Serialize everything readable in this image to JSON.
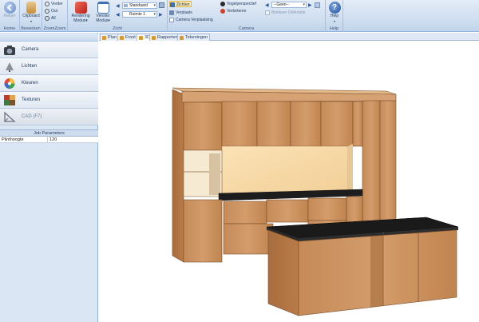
{
  "ribbon": {
    "home": {
      "return_label": "Return",
      "group_label": "Home"
    },
    "bewerken": {
      "clipboard_label": "Clipboard",
      "group_label": "Bewerken"
    },
    "zoom": {
      "items": [
        "Vorder",
        "Out",
        "All"
      ],
      "group_label": "ZoomZoom"
    },
    "zicht": {
      "rendering_label": "Rendering",
      "rendering_sub": "Modus",
      "venster_label": "Venster",
      "venster_sub": "Modus",
      "view_combo": "Standaard",
      "room_combo": "Ruimte 1",
      "group_label": "Zicht"
    },
    "camera": {
      "items_left": [
        "Zichten",
        "Verplaats",
        "Camera Verplaatsing"
      ],
      "items_mid": [
        "Vogelperspectief",
        "Verbeteren"
      ],
      "geen_combo": "--Geen--",
      "blokkeer_label": "Blokkeer Oriëntatie",
      "group_label": "Camera"
    },
    "help": {
      "help_label": "Help",
      "group_label": "Help"
    }
  },
  "leftpane": {
    "nav_items": [
      {
        "label": "Camera",
        "icon": "camera-icon"
      },
      {
        "label": "Lichten",
        "icon": "lamp-icon"
      },
      {
        "label": "Kleuren",
        "icon": "color-wheel-icon"
      },
      {
        "label": "Texturen",
        "icon": "textures-icon"
      },
      {
        "label": "CAD (F7)",
        "icon": "cad-icon"
      }
    ],
    "job_parameters": {
      "header": "Job Parameters",
      "rows": [
        {
          "name": "Plinthoogte",
          "value": "120"
        }
      ]
    }
  },
  "tabs": [
    "Plan",
    "Front",
    "3D",
    "Rapporten",
    "Tekeningen"
  ],
  "active_tab": "3D",
  "colors": {
    "ribbon_bg": "#cddcef",
    "pane_bg": "#dbe6f4",
    "wood": "#c98f5f",
    "countertop": "#1a1a1a",
    "niche_back": "#f6d9a8"
  }
}
